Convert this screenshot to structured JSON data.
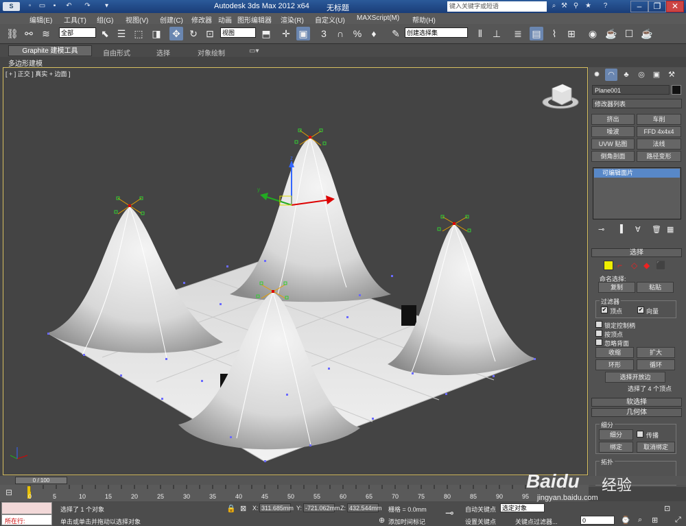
{
  "titlebar": {
    "app_title": "Autodesk 3ds Max  2012 x64",
    "doc_title": "无标题",
    "search_placeholder": "键入关键字或短语"
  },
  "menu": [
    "编辑(E)",
    "工具(T)",
    "组(G)",
    "视图(V)",
    "创建(C)",
    "修改器",
    "动画",
    "图形编辑器",
    "渲染(R)",
    "自定义(U)",
    "MAXScript(M)",
    "帮助(H)"
  ],
  "toolbar": {
    "selection_filter": "全部",
    "ref_coord": "视图",
    "named_selection": "创建选择集"
  },
  "ribbon": {
    "tabs": [
      "Graphite 建模工具",
      "自由形式",
      "选择",
      "对象绘制"
    ],
    "sub_label": "多边形建模"
  },
  "viewport": {
    "label": "[ + ] 正交 ] 真实 + 边面 ]"
  },
  "panel": {
    "object_name": "Plane001",
    "modifier_list": "修改器列表",
    "modifier_buttons": [
      "挤出",
      "车削",
      "噪波",
      "FFD 4x4x4",
      "UVW 贴图",
      "法线",
      "倒角剖面",
      "路径变形"
    ],
    "stack_item": "可编辑面片",
    "rollout_select": "选择",
    "named_sel_label": "命名选择:",
    "copy_btn": "复制",
    "paste_btn": "粘贴",
    "filter_label": "过滤器",
    "vertex_label": "顶点",
    "vector_label": "向量",
    "lock_handles": "锁定控制柄",
    "by_vertex": "按顶点",
    "ignore_backfacing": "忽略背面",
    "shrink_btn": "收缩",
    "grow_btn": "扩大",
    "ring_btn": "环形",
    "loop_btn": "循环",
    "select_open_edges": "选择开放边",
    "selected_count": "选择了 4 个顶点",
    "rollout_soft": "软选择",
    "rollout_geometry": "几何体",
    "subdivision_label": "细分",
    "subdivide_btn": "细分",
    "propagate_label": "传播",
    "bind_btn": "绑定",
    "unbind_btn": "取消绑定",
    "topology_label": "拓扑"
  },
  "timeline": {
    "slider": "0 / 100",
    "ticks": [
      "0",
      "5",
      "10",
      "15",
      "20",
      "25",
      "30",
      "35",
      "40",
      "45",
      "50",
      "55",
      "60",
      "65",
      "70",
      "75",
      "80",
      "85",
      "90",
      "95"
    ]
  },
  "status": {
    "running_label": "所在行:",
    "selected_msg": "选择了 1 个对象",
    "hint_msg": "单击或单击并拖动以选择对象",
    "x_value": "311.685mm",
    "y_value": "-721.062mm",
    "z_value": "432.544mm",
    "grid": "栅格 = 0.0mm",
    "add_time_tag": "添加时间标记",
    "auto_key": "自动关键点",
    "set_key": "设置关键点",
    "selected_object": "选定对象",
    "key_filters": "关键点过滤器...",
    "frame": "0"
  },
  "watermark": {
    "logo_text": "Baidu",
    "logo_cn": "经验",
    "site": "jingyan.baidu.com"
  }
}
